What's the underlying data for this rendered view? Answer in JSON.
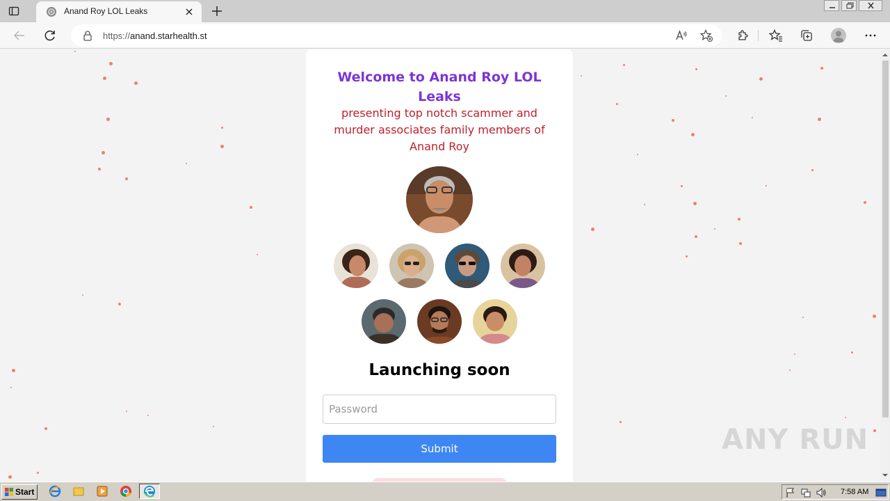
{
  "browser": {
    "tab_title": "Anand Roy LOL Leaks",
    "url_prefix": "https://",
    "url_host": "anand.starhealth.st"
  },
  "page": {
    "welcome_title": "Welcome to Anand Roy LOL Leaks",
    "subtitle": "presenting top notch scammer and murder associates family members of Anand Roy",
    "launching": "Launching soon",
    "password_placeholder": "Password",
    "submit_label": "Submit"
  },
  "watermark": "ANY RUN",
  "taskbar": {
    "start_label": "Start",
    "clock": "7:58 AM"
  },
  "colors": {
    "title_purple": "#7b35d8",
    "subtitle_red": "#c0202a",
    "submit_blue": "#3e86f3",
    "particle": "#e8836d"
  }
}
